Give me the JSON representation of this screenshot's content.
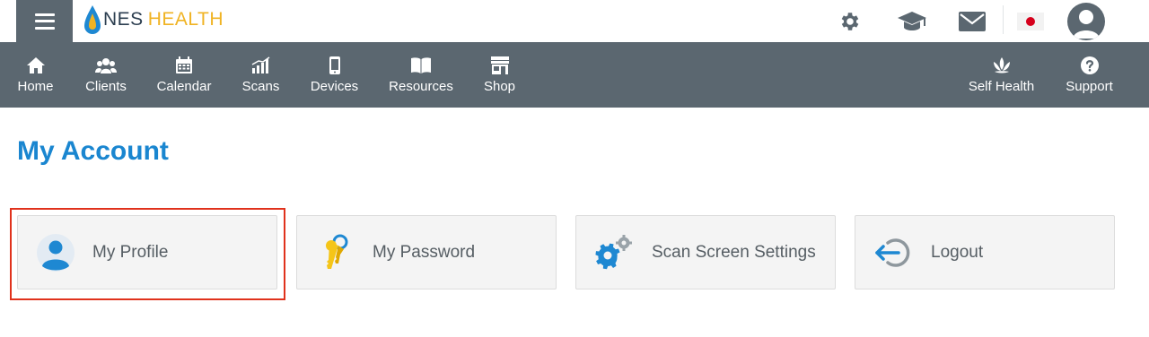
{
  "brand": {
    "name_part1": "NES",
    "name_part2": "HEALTH"
  },
  "header": {
    "icons": [
      "gear-icon",
      "graduation-cap-icon",
      "mail-icon",
      "japan-flag-icon",
      "user-avatar-icon"
    ]
  },
  "nav": {
    "left": [
      {
        "label": "Home",
        "icon": "home-icon"
      },
      {
        "label": "Clients",
        "icon": "users-icon"
      },
      {
        "label": "Calendar",
        "icon": "calendar-icon"
      },
      {
        "label": "Scans",
        "icon": "bar-chart-icon"
      },
      {
        "label": "Devices",
        "icon": "mobile-icon"
      },
      {
        "label": "Resources",
        "icon": "book-icon"
      },
      {
        "label": "Shop",
        "icon": "store-icon"
      }
    ],
    "right": [
      {
        "label": "Self Health",
        "icon": "lotus-icon"
      },
      {
        "label": "Support",
        "icon": "question-circle-icon"
      }
    ]
  },
  "page": {
    "title": "My Account"
  },
  "cards": [
    {
      "label": "My Profile",
      "icon": "user-circle-icon"
    },
    {
      "label": "My Password",
      "icon": "keys-icon"
    },
    {
      "label": "Scan Screen Settings",
      "icon": "cogs-icon"
    },
    {
      "label": "Logout",
      "icon": "logout-icon"
    }
  ],
  "colors": {
    "nav_bg": "#5b6770",
    "title": "#1a86d0",
    "accent_blue": "#1e88d2",
    "brand_gold": "#f0b323",
    "highlight": "#e0321c"
  }
}
